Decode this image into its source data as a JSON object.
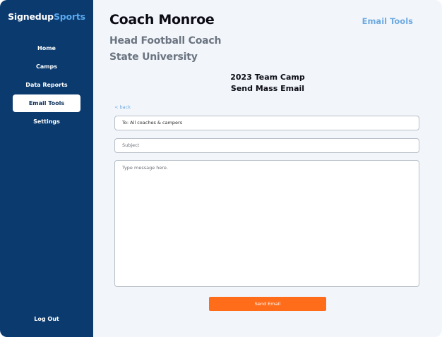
{
  "brand": {
    "part1": "Signedup",
    "part2": "Sports"
  },
  "sidebar": {
    "items": [
      {
        "label": "Home",
        "active": false
      },
      {
        "label": "Camps",
        "active": false
      },
      {
        "label": "Data Reports",
        "active": false
      },
      {
        "label": "Email Tools",
        "active": true
      },
      {
        "label": "Settings",
        "active": false
      }
    ],
    "logout_label": "Log Out"
  },
  "header": {
    "coach_name": "Coach Monroe",
    "role": "Head Football Coach",
    "school": "State University",
    "section_label": "Email Tools"
  },
  "email_form": {
    "camp_title": "2023 Team Camp",
    "form_title": "Send Mass Email",
    "back_label": "< back",
    "to_value": "To: All coaches & campers",
    "subject_placeholder": "Subject",
    "message_placeholder": "Type message here.",
    "send_label": "Send Email"
  },
  "colors": {
    "sidebar_bg": "#0a3a6e",
    "brand_accent": "#5aa8ee",
    "link_accent": "#6ea9e0",
    "send_button": "#ff6c1a",
    "page_bg": "#f2f6fb"
  }
}
